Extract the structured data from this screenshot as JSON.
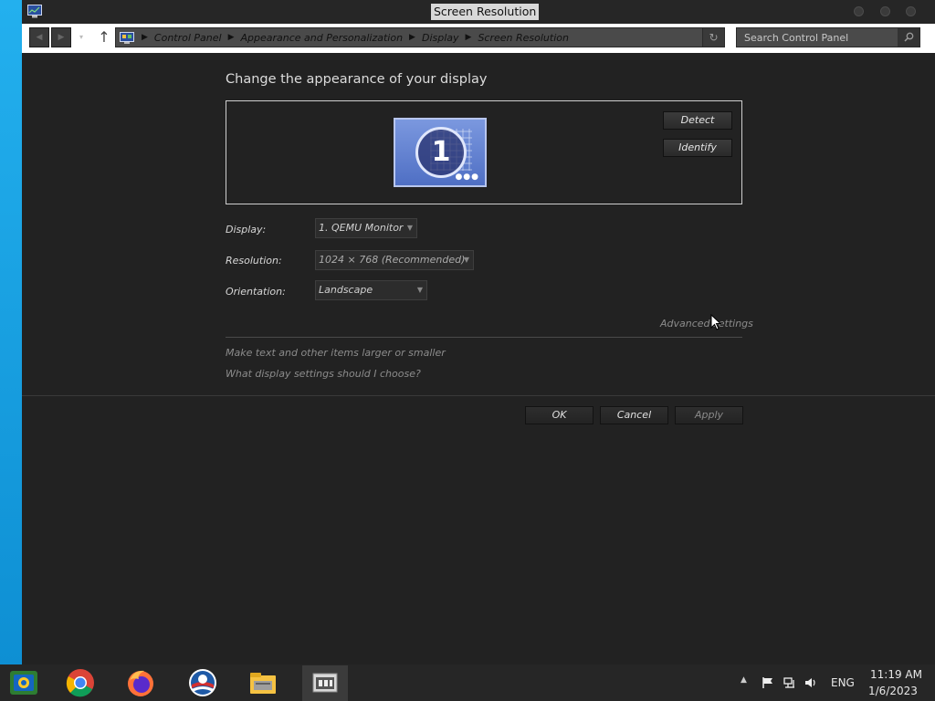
{
  "window": {
    "title": "Screen Resolution"
  },
  "navbar": {
    "breadcrumbs": [
      "Control Panel",
      "Appearance and Personalization",
      "Display",
      "Screen Resolution"
    ],
    "search_placeholder": "Search Control Panel"
  },
  "main": {
    "heading": "Change the appearance of your display",
    "monitor_number": "1",
    "detect_label": "Detect",
    "identify_label": "Identify",
    "display_label": "Display:",
    "display_value": "1. QEMU Monitor",
    "resolution_label": "Resolution:",
    "resolution_value": "1024 × 768 (Recommended)",
    "orientation_label": "Orientation:",
    "orientation_value": "Landscape",
    "advanced_settings": "Advanced settings",
    "link_text_size": "Make text and other items larger or smaller",
    "link_display_settings": "What display settings should I choose?",
    "ok_label": "OK",
    "cancel_label": "Cancel",
    "apply_label": "Apply"
  },
  "taskbar": {
    "apps": [
      "control-panel-icon",
      "chrome-icon",
      "firefox-icon",
      "obama-icon",
      "file-explorer-icon",
      "screen-resolution-icon"
    ],
    "language": "ENG",
    "time": "11:19 AM",
    "date": "1/6/2023"
  },
  "colors": {
    "window_bg": "#222222",
    "desktop": "#1fa3e0",
    "taskbar": "#262626"
  }
}
